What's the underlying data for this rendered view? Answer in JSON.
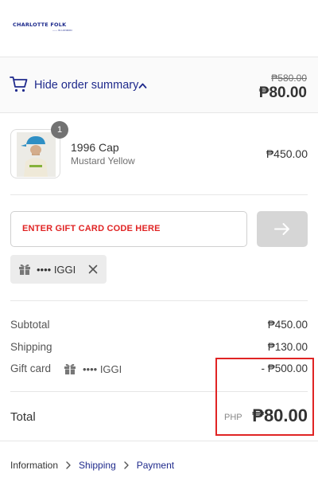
{
  "header": {
    "logo_text": "CHARLOTTE FOLK",
    "logo_subtext": "—— IN LONDON"
  },
  "summary": {
    "toggle_label": "Hide order summary",
    "original_price": "₱580.00",
    "current_price": "₱80.00"
  },
  "product": {
    "quantity": "1",
    "name": "1996 Cap",
    "variant": "Mustard Yellow",
    "price": "₱450.00"
  },
  "gift_card": {
    "placeholder": "ENTER GIFT CARD CODE HERE",
    "applied_code": "•••• IGGI"
  },
  "totals": {
    "subtotal_label": "Subtotal",
    "subtotal_value": "₱450.00",
    "shipping_label": "Shipping",
    "shipping_value": "₱130.00",
    "giftcard_label": "Gift card",
    "giftcard_code": "•••• IGGI",
    "giftcard_value": "- ₱500.00",
    "total_label": "Total",
    "total_currency": "PHP",
    "total_value": "₱80.00"
  },
  "breadcrumb": {
    "information": "Information",
    "shipping": "Shipping",
    "payment": "Payment"
  },
  "colors": {
    "accent": "#1f2a8c",
    "highlight": "#e02424",
    "placeholder": "#e02424"
  },
  "icons": [
    "cart-icon",
    "chevron-up-icon",
    "gift-icon",
    "close-icon",
    "arrow-right-icon",
    "chevron-right-icon"
  ]
}
